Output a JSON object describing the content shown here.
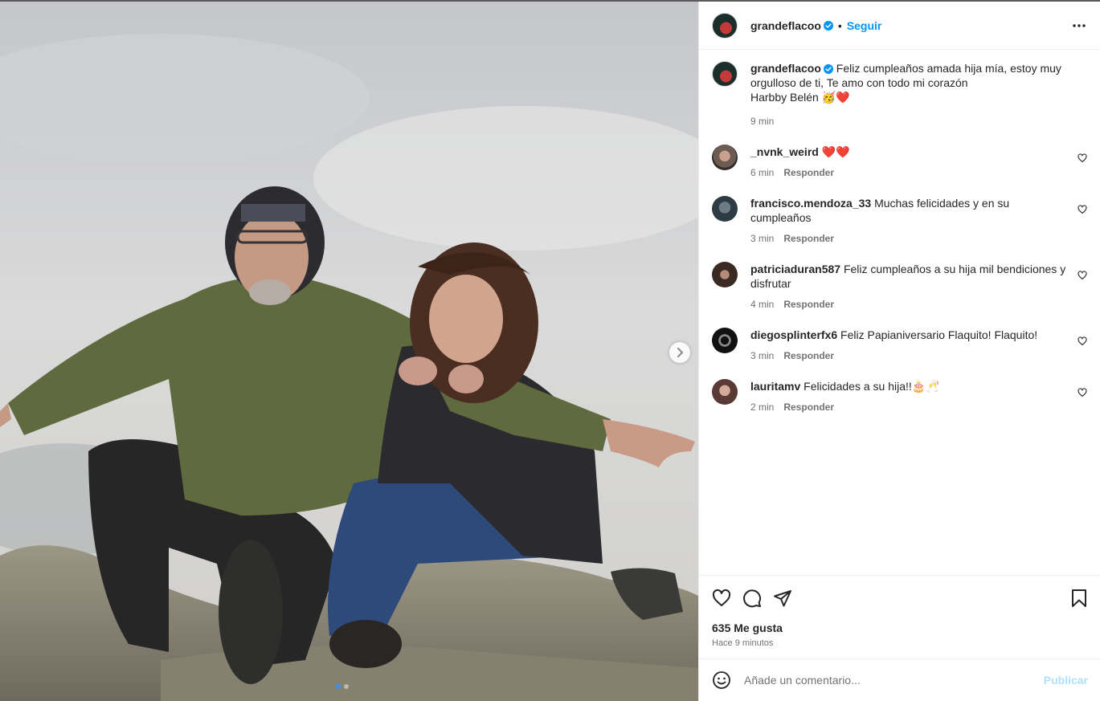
{
  "post": {
    "author": "grandeflacoo",
    "follow_label": "Seguir",
    "separator": "•",
    "caption_line1": "Feliz cumpleaños amada hija mía, estoy muy orgulloso de ti, Te amo con todo mi corazón",
    "caption_line2": "Harbby Belén 🥳❤️",
    "caption_time": "9 min",
    "image_description_icon": "photo",
    "carousel": {
      "total": 2,
      "active": 1
    }
  },
  "comments": [
    {
      "user": "_nvnk_weird",
      "text": "❤️❤️",
      "time": "6 min",
      "reply": "Responder"
    },
    {
      "user": "francisco.mendoza_33",
      "text": "Muchas felicidades y en su cumpleaños",
      "time": "3 min",
      "reply": "Responder"
    },
    {
      "user": "patriciaduran587",
      "text": "Feliz cumpleaños a su hija mil bendiciones y disfrutar",
      "time": "4 min",
      "reply": "Responder"
    },
    {
      "user": "diegosplinterfx6",
      "text": "Feliz Papianiversario Flaquito! Flaquito!",
      "time": "3 min",
      "reply": "Responder"
    },
    {
      "user": "lauritamv",
      "text": "Felicidades a su hija!!🎂🥂",
      "time": "2 min",
      "reply": "Responder"
    }
  ],
  "stats": {
    "likes": "635 Me gusta",
    "posted": "Hace 9 minutos"
  },
  "composer": {
    "placeholder": "Añade un comentario...",
    "publish_label": "Publicar"
  },
  "colors": {
    "link": "#0095f6",
    "verified": "#0095f6",
    "publish_disabled": "#b2dffc",
    "muted": "#737373"
  }
}
